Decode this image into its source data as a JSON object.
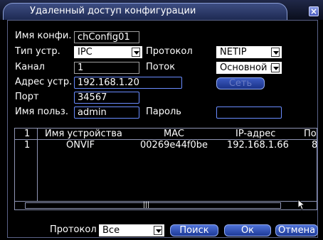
{
  "window": {
    "title": "Удаленный доступ конфигурации",
    "close_label": "×"
  },
  "form": {
    "config_name": {
      "label": "Имя конфи.",
      "value": "chConfig01"
    },
    "device_type": {
      "label": "Тип устр.",
      "value": "IPC"
    },
    "protocol": {
      "label": "Протокол",
      "value": "NETIP"
    },
    "channel": {
      "label": "Канал",
      "value": "1"
    },
    "stream": {
      "label": "Поток",
      "value": "Основной п"
    },
    "device_address": {
      "label": "Адрес устр.",
      "value": "192.168.1.20"
    },
    "network_button": "Сеть",
    "port": {
      "label": "Порт",
      "value": "34567"
    },
    "username": {
      "label": "Имя польз.",
      "value": "admin"
    },
    "password": {
      "label": "Пароль",
      "value": ""
    }
  },
  "table": {
    "columns": [
      "1",
      "Имя устройства",
      "MAC",
      "IP-адрес",
      "По"
    ],
    "rows": [
      {
        "num": "1",
        "name": "ONVIF",
        "mac": "00269e44f0be",
        "ip": "192.168.1.66",
        "port": "8"
      }
    ],
    "scroll_grip": "|||"
  },
  "bottom": {
    "protocol_label": "Протокол",
    "protocol_value": "Все",
    "search_button": "Поиск",
    "ok_button": "Ок",
    "cancel_button": "Отмена"
  },
  "colors": {
    "title_bar": "#1e2a52",
    "button": "#2c4cc0",
    "panel_border": "#5a6288"
  }
}
